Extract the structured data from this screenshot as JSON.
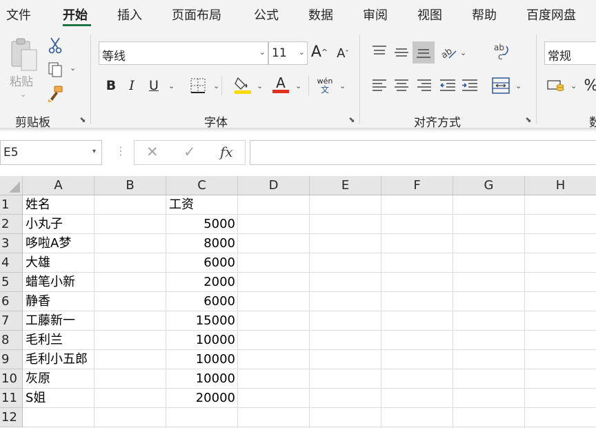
{
  "ribbon_tabs": [
    {
      "label": "文件",
      "active": false
    },
    {
      "label": "开始",
      "active": true
    },
    {
      "label": "插入",
      "active": false
    },
    {
      "label": "页面布局",
      "active": false
    },
    {
      "label": "公式",
      "active": false
    },
    {
      "label": "数据",
      "active": false
    },
    {
      "label": "审阅",
      "active": false
    },
    {
      "label": "视图",
      "active": false
    },
    {
      "label": "帮助",
      "active": false
    },
    {
      "label": "百度网盘",
      "active": false
    }
  ],
  "clipboard": {
    "paste_label": "粘贴",
    "group_label": "剪贴板"
  },
  "font": {
    "font_name": "等线",
    "font_size": "11",
    "group_label": "字体",
    "phonetic_top": "wén",
    "phonetic_bottom": "文"
  },
  "alignment": {
    "group_label": "对齐方式"
  },
  "number": {
    "format": "常规",
    "group_label_partial": "数"
  },
  "formula_bar": {
    "name_box": "E5",
    "formula": ""
  },
  "columns": [
    "A",
    "B",
    "C",
    "D",
    "E",
    "F",
    "G",
    "H"
  ],
  "rows": [
    "1",
    "2",
    "3",
    "4",
    "5",
    "6",
    "7",
    "8",
    "9",
    "10",
    "11",
    "12"
  ],
  "sheet": {
    "header": {
      "name": "姓名",
      "salary": "工资"
    },
    "records": [
      {
        "name": "小丸子",
        "salary": "5000"
      },
      {
        "name": "哆啦A梦",
        "salary": "8000"
      },
      {
        "name": "大雄",
        "salary": "6000"
      },
      {
        "name": "蜡笔小新",
        "salary": "2000"
      },
      {
        "name": "静香",
        "salary": "6000"
      },
      {
        "name": "工藤新一",
        "salary": "15000"
      },
      {
        "name": "毛利兰",
        "salary": "10000"
      },
      {
        "name": "毛利小五郎",
        "salary": "10000"
      },
      {
        "name": "灰原",
        "salary": "10000"
      },
      {
        "name": "S姐",
        "salary": "20000"
      }
    ]
  },
  "colors": {
    "accent": "#217346",
    "font_color": "#e0301e",
    "highlight": "#ffd800"
  }
}
